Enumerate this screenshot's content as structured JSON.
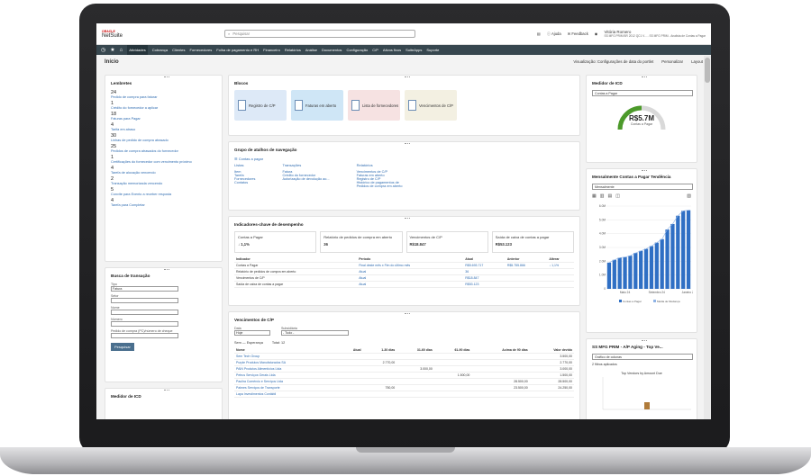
{
  "brand": {
    "oracle": "ORACLE",
    "netsuite": "NetSuite"
  },
  "search": {
    "placeholder": "Pesquisar"
  },
  "header": {
    "help": "Ajuda",
    "feedback": "Feedback",
    "user_name": "Vitória Romero",
    "user_role": "SS MFG PRIM BR 2012 QC1 V... - SS MFG PRIM - Analista de Contas a Pagar"
  },
  "nav": [
    "Atividades",
    "Cobrança",
    "Clientes",
    "Fornecedores",
    "Folha de pagamento e RH",
    "Financeiro",
    "Relatórios",
    "Análise",
    "Documentos",
    "Configuração",
    "C/P",
    "Ativos fixos",
    "SuiteApps",
    "Suporte"
  ],
  "page": {
    "title": "Início",
    "view": "Visualização: Configurações de data do portlet",
    "personalize": "Personalizar",
    "layout": "Layout"
  },
  "reminders": {
    "title": "Lembretes",
    "items": [
      {
        "n": "24",
        "l": "Pedido de compra para faturar"
      },
      {
        "n": "1",
        "l": "Crédito do fornecedor a aplicar"
      },
      {
        "n": "18",
        "l": "Faturas para Pagar"
      },
      {
        "n": "4",
        "l": "Tarifa em atraso"
      },
      {
        "n": "30",
        "l": "Linhas de pedido de compra atrasado"
      },
      {
        "n": "25",
        "l": "Pedidos de compra atrasados do fornecedor"
      },
      {
        "n": "1",
        "l": "Certificações do fornecedor com vencimento próximo"
      },
      {
        "n": "4",
        "l": "Tarefa de alocação vencendo"
      },
      {
        "n": "2",
        "l": "Transação memorizada vencendo"
      },
      {
        "n": "5",
        "l": "Convite para Evento a receber resposta"
      },
      {
        "n": "4",
        "l": "Tarefa para Completar"
      }
    ]
  },
  "tx_search": {
    "title": "Busca de transação",
    "fields": [
      {
        "l": "Tipo",
        "v": "Fatura"
      },
      {
        "l": "Setor",
        "v": ""
      },
      {
        "l": "Nome",
        "v": ""
      },
      {
        "l": "Número",
        "v": ""
      },
      {
        "l": "Pedido de compra (PC)/número de cheque",
        "v": ""
      }
    ],
    "button": "Pesquisar"
  },
  "icd_left": {
    "title": "Medidor de ICD"
  },
  "blocks": {
    "title": "Blocos",
    "tiles": [
      {
        "label": "Registro de C/P",
        "color": "#dde9f7"
      },
      {
        "label": "Faturas em aberto",
        "color": "#cfe6f6"
      },
      {
        "label": "Lista de fornecedores",
        "color": "#f6e2e2"
      },
      {
        "label": "Vencimentos de C/P",
        "color": "#f3f0e2"
      }
    ]
  },
  "shortcuts": {
    "title": "Grupo de atalhos de navegação",
    "add": "Contas a pagar",
    "cols": [
      {
        "h": "Listas",
        "items": [
          "Item",
          "Tarefa",
          "Fornecedores",
          "Contatos"
        ]
      },
      {
        "h": "Transações",
        "items": [
          "Fatura",
          "Crédito do fornecedor",
          "Autorização de devolução ao..."
        ]
      },
      {
        "h": "Relatórios",
        "items": [
          "Vencimentos de C/P",
          "Faturas em aberto",
          "Registro de C/P",
          "Histórico de pagamentos de",
          "Pedidos de compra em aberto"
        ]
      }
    ]
  },
  "kpi": {
    "title": "Indicadores-chave de desempenho",
    "cards": [
      {
        "label": "Contas a Pagar",
        "value": "↓ 1,1%"
      },
      {
        "label": "Relatório de pedidos de compra em aberto",
        "value": "36"
      },
      {
        "label": "Vencimentos de C/P",
        "value": "R$18.847"
      },
      {
        "label": "Saída de caixa de contas a pagar",
        "value": "R$53.123"
      }
    ],
    "headers": [
      "Indicador",
      "Período",
      "Atual",
      "Anterior",
      "Alterar"
    ],
    "rows": [
      [
        "Contas a Pagar",
        "Final deste mês x Fim do último mês",
        "R$5.693.717",
        "R$5.755.866",
        "↓ 1,1%"
      ],
      [
        "Relatório de pedidos de compra em aberto",
        "Atual",
        "36",
        "",
        ""
      ],
      [
        "Vencimentos de C/P",
        "Atual",
        "R$18.847",
        "",
        ""
      ],
      [
        "Saída de caixa de contas a pagar",
        "Atual",
        "R$53.123",
        "",
        ""
      ]
    ]
  },
  "aging": {
    "title": "Vencimentos de C/P",
    "date_label": "Data",
    "date_value": "Hoje",
    "sub_label": "Subsidiária",
    "sub_value": "- Tudo -",
    "filter": "Sem — Esperança",
    "total": "Total: 12",
    "headers": [
      "Nome",
      "Atual",
      "1-30 dias",
      "31-60 dias",
      "61-90 dias",
      "Acima de 90 dias",
      "Valor devido"
    ],
    "rows": [
      [
        "Sem Tech Group",
        "",
        "",
        "",
        "",
        "",
        "3.500,00"
      ],
      [
        "Purple Produtos Manufaturados SA",
        "",
        "2.770,00",
        "",
        "",
        "",
        "2.770,00"
      ],
      [
        "PAIN Produtos Alimentícios Ltda",
        "",
        "",
        "3.000,00",
        "",
        "",
        "3.000,00"
      ],
      [
        "Petrus Serviços Gerais Ltda",
        "",
        "",
        "",
        "1.500,00",
        "",
        "1.500,00"
      ],
      [
        "Paulira Comércio e Serviços Ltda",
        "",
        "",
        "",
        "",
        "28.500,00",
        "28.500,00"
      ],
      [
        "Palmes Serviços de Transporte",
        "",
        "750,00",
        "",
        "",
        "23.500,00",
        "24.250,00"
      ],
      [
        "Lapa Investimentos Contábil",
        "",
        "",
        "",
        "",
        "",
        ""
      ]
    ]
  },
  "icd": {
    "title": "Medidor de ICD",
    "select": "Contas a Pagar",
    "value": "R$5.7M",
    "sub": "Contas a Pagar"
  },
  "trend": {
    "title": "Mensalmente Contas a Pagar Tendência",
    "select": "Mensalmente",
    "legend": [
      "Contas a Pagar",
      "Média de Mudança"
    ]
  },
  "aptop": {
    "title": "SS MFG PRIM - A/P Aging - Top Ve...",
    "select": "Gráfico de colunas",
    "filter": "2 filtros aplicados",
    "chart_title": "Top Vendors by Amount Due"
  },
  "chart_data": {
    "type": "bar",
    "categories": [
      "Maio 24",
      "Setembro 24",
      "Janeiro 25"
    ],
    "ylim": [
      0,
      6000000
    ],
    "yticks": [
      "0",
      "1.0M",
      "2.0M",
      "3.0M",
      "4.0M",
      "5.0M",
      "6.0M"
    ],
    "series": [
      {
        "name": "Contas a Pagar",
        "values": [
          1900000,
          2100000,
          2250000,
          2300000,
          2400000,
          2600000,
          2750000,
          2900000,
          3100000,
          3350000,
          3600000,
          4300000,
          4700000,
          5300000,
          5650000,
          5700000
        ]
      },
      {
        "name": "Média de Mudança",
        "values": []
      }
    ]
  },
  "colors": {
    "nav": "#37474f",
    "accent": "#2e6bb0",
    "gauge": "#4c9a2a",
    "bar": "#2f6fc4"
  }
}
